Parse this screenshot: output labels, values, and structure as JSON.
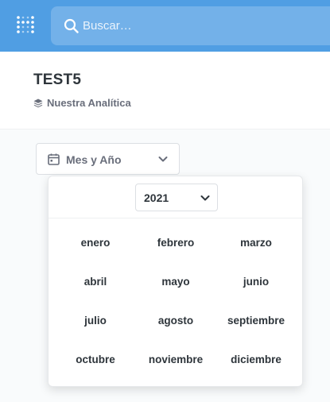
{
  "search": {
    "placeholder": "Buscar…"
  },
  "header": {
    "title": "TEST5",
    "collection": "Nuestra Analítica"
  },
  "filter": {
    "label": "Mes y Año"
  },
  "picker": {
    "year": "2021",
    "months": [
      [
        "enero",
        "febrero",
        "marzo"
      ],
      [
        "abril",
        "mayo",
        "junio"
      ],
      [
        "julio",
        "agosto",
        "septiembre"
      ],
      [
        "octubre",
        "noviembre",
        "diciembre"
      ]
    ]
  },
  "colors": {
    "brand": "#509ee3",
    "text": "#2e353b",
    "muted": "#696e7b"
  },
  "icons": {
    "logo": "logo-dots-icon",
    "search": "search-icon",
    "collection": "collection-stack-icon",
    "calendar": "calendar-icon",
    "chevron": "chevron-down-icon"
  }
}
